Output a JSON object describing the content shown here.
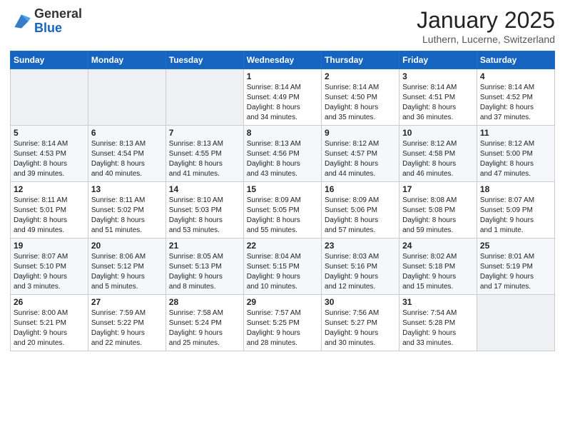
{
  "logo": {
    "general": "General",
    "blue": "Blue"
  },
  "title": "January 2025",
  "subtitle": "Luthern, Lucerne, Switzerland",
  "weekdays": [
    "Sunday",
    "Monday",
    "Tuesday",
    "Wednesday",
    "Thursday",
    "Friday",
    "Saturday"
  ],
  "weeks": [
    [
      {
        "day": null,
        "info": null
      },
      {
        "day": null,
        "info": null
      },
      {
        "day": null,
        "info": null
      },
      {
        "day": "1",
        "info": "Sunrise: 8:14 AM\nSunset: 4:49 PM\nDaylight: 8 hours\nand 34 minutes."
      },
      {
        "day": "2",
        "info": "Sunrise: 8:14 AM\nSunset: 4:50 PM\nDaylight: 8 hours\nand 35 minutes."
      },
      {
        "day": "3",
        "info": "Sunrise: 8:14 AM\nSunset: 4:51 PM\nDaylight: 8 hours\nand 36 minutes."
      },
      {
        "day": "4",
        "info": "Sunrise: 8:14 AM\nSunset: 4:52 PM\nDaylight: 8 hours\nand 37 minutes."
      }
    ],
    [
      {
        "day": "5",
        "info": "Sunrise: 8:14 AM\nSunset: 4:53 PM\nDaylight: 8 hours\nand 39 minutes."
      },
      {
        "day": "6",
        "info": "Sunrise: 8:13 AM\nSunset: 4:54 PM\nDaylight: 8 hours\nand 40 minutes."
      },
      {
        "day": "7",
        "info": "Sunrise: 8:13 AM\nSunset: 4:55 PM\nDaylight: 8 hours\nand 41 minutes."
      },
      {
        "day": "8",
        "info": "Sunrise: 8:13 AM\nSunset: 4:56 PM\nDaylight: 8 hours\nand 43 minutes."
      },
      {
        "day": "9",
        "info": "Sunrise: 8:12 AM\nSunset: 4:57 PM\nDaylight: 8 hours\nand 44 minutes."
      },
      {
        "day": "10",
        "info": "Sunrise: 8:12 AM\nSunset: 4:58 PM\nDaylight: 8 hours\nand 46 minutes."
      },
      {
        "day": "11",
        "info": "Sunrise: 8:12 AM\nSunset: 5:00 PM\nDaylight: 8 hours\nand 47 minutes."
      }
    ],
    [
      {
        "day": "12",
        "info": "Sunrise: 8:11 AM\nSunset: 5:01 PM\nDaylight: 8 hours\nand 49 minutes."
      },
      {
        "day": "13",
        "info": "Sunrise: 8:11 AM\nSunset: 5:02 PM\nDaylight: 8 hours\nand 51 minutes."
      },
      {
        "day": "14",
        "info": "Sunrise: 8:10 AM\nSunset: 5:03 PM\nDaylight: 8 hours\nand 53 minutes."
      },
      {
        "day": "15",
        "info": "Sunrise: 8:09 AM\nSunset: 5:05 PM\nDaylight: 8 hours\nand 55 minutes."
      },
      {
        "day": "16",
        "info": "Sunrise: 8:09 AM\nSunset: 5:06 PM\nDaylight: 8 hours\nand 57 minutes."
      },
      {
        "day": "17",
        "info": "Sunrise: 8:08 AM\nSunset: 5:08 PM\nDaylight: 8 hours\nand 59 minutes."
      },
      {
        "day": "18",
        "info": "Sunrise: 8:07 AM\nSunset: 5:09 PM\nDaylight: 9 hours\nand 1 minute."
      }
    ],
    [
      {
        "day": "19",
        "info": "Sunrise: 8:07 AM\nSunset: 5:10 PM\nDaylight: 9 hours\nand 3 minutes."
      },
      {
        "day": "20",
        "info": "Sunrise: 8:06 AM\nSunset: 5:12 PM\nDaylight: 9 hours\nand 5 minutes."
      },
      {
        "day": "21",
        "info": "Sunrise: 8:05 AM\nSunset: 5:13 PM\nDaylight: 9 hours\nand 8 minutes."
      },
      {
        "day": "22",
        "info": "Sunrise: 8:04 AM\nSunset: 5:15 PM\nDaylight: 9 hours\nand 10 minutes."
      },
      {
        "day": "23",
        "info": "Sunrise: 8:03 AM\nSunset: 5:16 PM\nDaylight: 9 hours\nand 12 minutes."
      },
      {
        "day": "24",
        "info": "Sunrise: 8:02 AM\nSunset: 5:18 PM\nDaylight: 9 hours\nand 15 minutes."
      },
      {
        "day": "25",
        "info": "Sunrise: 8:01 AM\nSunset: 5:19 PM\nDaylight: 9 hours\nand 17 minutes."
      }
    ],
    [
      {
        "day": "26",
        "info": "Sunrise: 8:00 AM\nSunset: 5:21 PM\nDaylight: 9 hours\nand 20 minutes."
      },
      {
        "day": "27",
        "info": "Sunrise: 7:59 AM\nSunset: 5:22 PM\nDaylight: 9 hours\nand 22 minutes."
      },
      {
        "day": "28",
        "info": "Sunrise: 7:58 AM\nSunset: 5:24 PM\nDaylight: 9 hours\nand 25 minutes."
      },
      {
        "day": "29",
        "info": "Sunrise: 7:57 AM\nSunset: 5:25 PM\nDaylight: 9 hours\nand 28 minutes."
      },
      {
        "day": "30",
        "info": "Sunrise: 7:56 AM\nSunset: 5:27 PM\nDaylight: 9 hours\nand 30 minutes."
      },
      {
        "day": "31",
        "info": "Sunrise: 7:54 AM\nSunset: 5:28 PM\nDaylight: 9 hours\nand 33 minutes."
      },
      {
        "day": null,
        "info": null
      }
    ]
  ]
}
